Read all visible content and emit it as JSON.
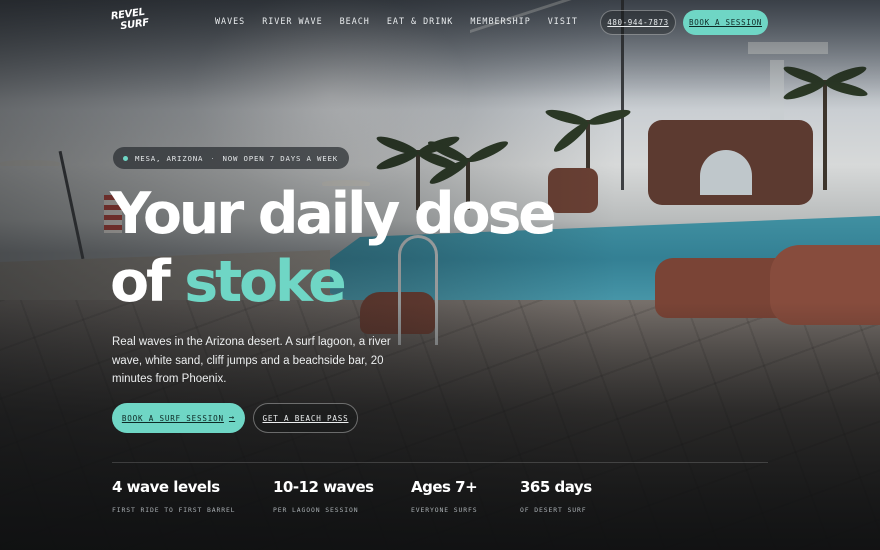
{
  "header": {
    "logo": {
      "line1": "REVEL",
      "line2": "SURF"
    },
    "nav": [
      "WAVES",
      "RIVER WAVE",
      "BEACH",
      "EAT & DRINK",
      "MEMBERSHIP",
      "VISIT"
    ],
    "phone": "480-944-7873",
    "book_label": "BOOK A SESSION"
  },
  "hero": {
    "pill": {
      "location": "MESA, ARIZONA",
      "separator": "·",
      "status": "NOW OPEN 7 DAYS A WEEK"
    },
    "headline": {
      "line1": "Your daily dose",
      "line2_prefix": "of",
      "line2_accent": "stoke"
    },
    "lede": "Real waves in the Arizona desert. A surf lagoon, a river wave, white sand, cliff jumps and a beachside bar, 20 minutes from Phoenix.",
    "cta_primary": {
      "label": "BOOK A SURF SESSION",
      "arrow": "→"
    },
    "cta_secondary": "GET A BEACH PASS"
  },
  "stats": [
    {
      "value": "4 wave levels",
      "caption": "FIRST RIDE TO FIRST BARREL"
    },
    {
      "value": "10-12 waves",
      "caption": "PER LAGOON SESSION"
    },
    {
      "value": "Ages 7+",
      "caption": "EVERYONE SURFS"
    },
    {
      "value": "365 days",
      "caption": "OF DESERT SURF"
    }
  ],
  "colors": {
    "accent": "#6fd6c5",
    "text": "#ffffff",
    "muted": "#a9afb3"
  },
  "icons": {
    "pill_dot": "status-dot-icon",
    "cta_arrow": "arrow-right-icon"
  }
}
